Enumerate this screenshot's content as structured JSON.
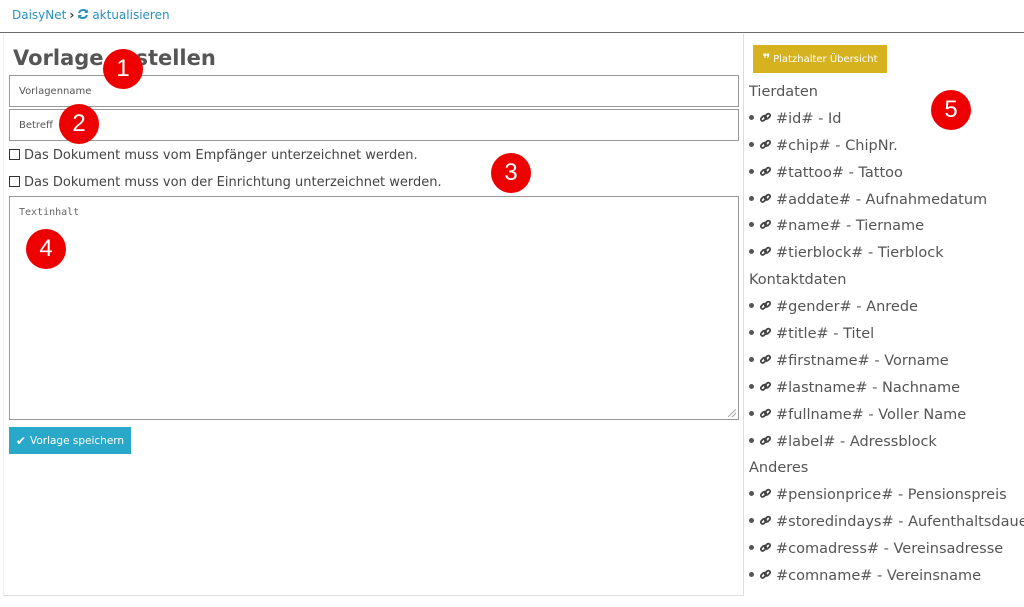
{
  "breadcrumb": {
    "root": "DaisyNet",
    "separator": "›",
    "current": "aktualisieren"
  },
  "form": {
    "title": "Vorlage erstellen",
    "name_placeholder": "Vorlagenname",
    "subject_placeholder": "Betreff",
    "check_recipient": "Das Dokument muss vom Empfänger unterzeichnet werden.",
    "check_facility": "Das Dokument muss von der Einrichtung unterzeichnet werden.",
    "content_placeholder": "Textinhalt",
    "save_label": "Vorlage speichern"
  },
  "sidebar": {
    "overview_label": "Platzhalter Übersicht",
    "groups": [
      {
        "title": "Tierdaten",
        "items": [
          "#id# - Id",
          "#chip# - ChipNr.",
          "#tattoo# - Tattoo",
          "#addate# - Aufnahmedatum",
          "#name# - Tiername",
          "#tierblock# - Tierblock"
        ]
      },
      {
        "title": "Kontaktdaten",
        "items": [
          "#gender# - Anrede",
          "#title# - Titel",
          "#firstname# - Vorname",
          "#lastname# - Nachname",
          "#fullname# - Voller Name",
          "#label# - Adressblock"
        ]
      },
      {
        "title": "Anderes",
        "items": [
          "#pensionprice# - Pensionspreis",
          "#storedindays# - Aufenthaltsdauer",
          "#comadress# - Vereinsadresse",
          "#comname# - Vereinsname"
        ]
      }
    ]
  },
  "markers": [
    "1",
    "2",
    "3",
    "4",
    "5"
  ],
  "colors": {
    "link": "#2a8fbd",
    "primary_button": "#2aa8c9",
    "warning_button": "#d6b21f",
    "marker": "#ee0000"
  }
}
